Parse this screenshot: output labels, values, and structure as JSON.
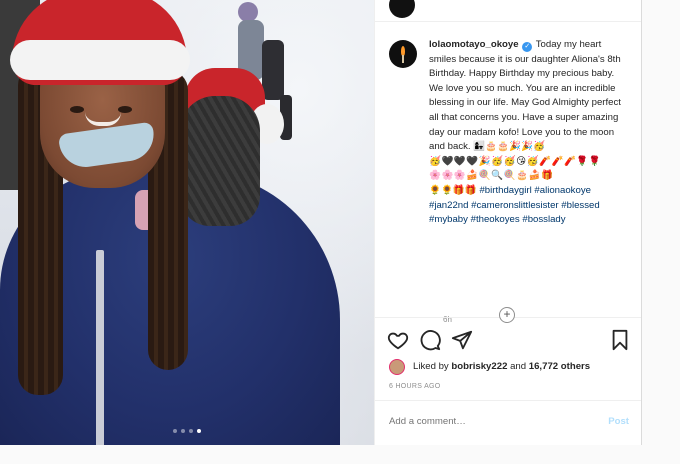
{
  "post": {
    "username": "lolaomotayo_okoye",
    "verified_mark": "✓",
    "caption_text": "Today my heart smiles because it is our daughter Aliona's 8th Birthday. Happy Birthday my precious baby. We love you so much. You are an incredible blessing in our life. May God Almighty perfect all that concerns you. Have a super amazing day our madam kofo! Love you to the moon and back.",
    "emoji_line_1": "👩‍👧🎂🎂🎉🎉🥳",
    "emoji_line_2": "🥳🖤🖤🖤🎉🥳🥳😘🥳🧨🧨🧨🌹🌹",
    "emoji_line_3": "🌸🌸🌸🍰🍭🔍🍭🎂🍰🎁",
    "emoji_line_4": "🌻🌻🎁🎁",
    "hashtags": [
      "#birthdaygirl",
      "#alionaokoye",
      "#jan22nd",
      "#cameronslittlesister",
      "#blessed",
      "#mybaby",
      "#theokoyes",
      "#bosslady"
    ],
    "posted_ago": "6h",
    "load_more": "+"
  },
  "actions": {
    "like_icon": "heart-icon",
    "comment_icon": "comment-icon",
    "share_icon": "send-icon",
    "save_icon": "bookmark-icon"
  },
  "likes": {
    "prefix": "Liked by",
    "user": "bobrisky222",
    "joiner": "and",
    "others": "16,772 others"
  },
  "timestamp": "6 HOURS AGO",
  "comment": {
    "placeholder": "Add a comment…",
    "post_label": "Post"
  },
  "carousel": {
    "count": 4,
    "active_index": 3
  },
  "colors": {
    "link_blue": "#00376b",
    "verified_blue": "#3897f0",
    "post_disabled": "#b2dffc",
    "muted_gray": "#8e8e8e"
  }
}
